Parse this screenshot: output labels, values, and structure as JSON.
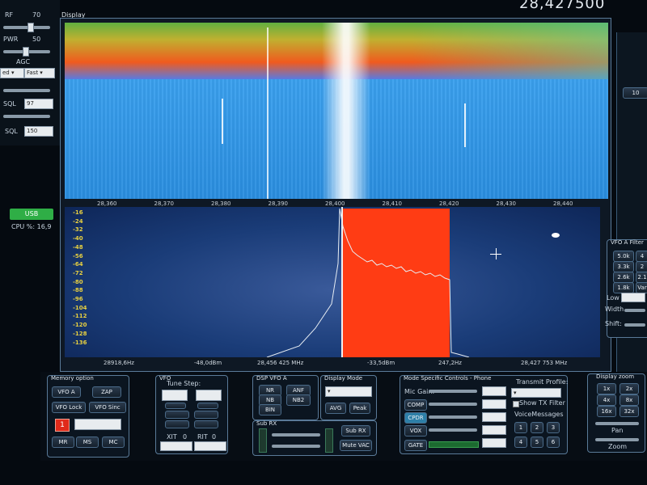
{
  "top_left": {
    "rf_label": "RF",
    "rf_value": "70",
    "pwr_label": "PWR",
    "pwr_value": "50",
    "agc_label": "AGC",
    "agc_select1": "ed",
    "agc_select2": "Fast",
    "sql1_label": "SQL",
    "sql1_value": "97",
    "sql2_label": "SQL",
    "sql2_value": "150",
    "mode_label": "USB",
    "cpu_label": "CPU %: 16,9"
  },
  "header": {
    "display_title": "Display",
    "big_freq": "28,427500"
  },
  "waterfall": {
    "freq_ticks": [
      "28,360",
      "28,370",
      "28,380",
      "28,390",
      "28,400",
      "28,410",
      "28,420",
      "28,430",
      "28,440"
    ]
  },
  "panadapter": {
    "db_ticks": [
      "-16",
      "-24",
      "-32",
      "-40",
      "-48",
      "-56",
      "-64",
      "-72",
      "-80",
      "-88",
      "-96",
      "-104",
      "-112",
      "-120",
      "-128",
      "-136"
    ],
    "status": {
      "left_hz": "28918,6Hz",
      "dbm1": "-48,0dBm",
      "mhz1": "28,456 425 MHz",
      "dbm2": "-33,5dBm",
      "hz2": "247,2Hz",
      "mhz2": "28,427 753 MHz"
    }
  },
  "right_side": {
    "label_10": "10",
    "vfo_a_filter": "VFO A Filter",
    "filter_buttons": [
      "5.0k",
      "4",
      "3.3k",
      "2",
      "2.6k",
      "2.1",
      "1.8k",
      "Var"
    ],
    "low_label": "Low",
    "width_label": "Width",
    "shift_label": "Shift:"
  },
  "memory": {
    "title": "Memory option",
    "vfo_a": "VFO A",
    "zap": "ZAP",
    "vfo_lock": "VFO Lock",
    "vfo_sinc": "VFO Sinc",
    "mem_num": "1",
    "mr": "MR",
    "ms": "MS",
    "mc": "MC"
  },
  "vfo": {
    "title": "VFO",
    "tune_step": "Tune Step:",
    "xit": "XIT",
    "xit_val": "0",
    "rit": "RIT",
    "rit_val": "0"
  },
  "dsp": {
    "title": "DSP VFO A",
    "nr": "NR",
    "anf": "ANF",
    "nb": "NB",
    "nb2": "NB2",
    "bin": "BIN"
  },
  "display_mode": {
    "title": "Display Mode",
    "avg": "AVG",
    "peak": "Peak"
  },
  "sub_rx": {
    "title": "Sub RX",
    "sub_rx_btn": "Sub RX",
    "mute_vac": "Mute VAC"
  },
  "mode_specific": {
    "title": "Mode Specific Controls - Phone",
    "mic_gain": "Mic Gain:",
    "comp": "COMP",
    "cpdr": "CPDR",
    "vox": "VOX",
    "gate": "GATE",
    "transmit_profile": "Transmit Profile:",
    "show_tx_filter": "Show TX Filter",
    "voice_messages": "VoiceMessages",
    "vm_buttons": [
      "1",
      "2",
      "3",
      "4",
      "5",
      "6"
    ]
  },
  "display_zoom": {
    "title": "Display zoom",
    "buttons": [
      "1x",
      "2x",
      "4x",
      "8x",
      "16x",
      "32x"
    ],
    "pan": "Pan",
    "zoom": "Zoom"
  },
  "colors": {
    "waterfall_blue": "#2a8ee0",
    "waterfall_band": "#f05a1e",
    "passband": "#ff3c14",
    "pan_bg": "#1a3c78",
    "db_label": "#e8d040",
    "usb_badge": "#2fae46"
  }
}
